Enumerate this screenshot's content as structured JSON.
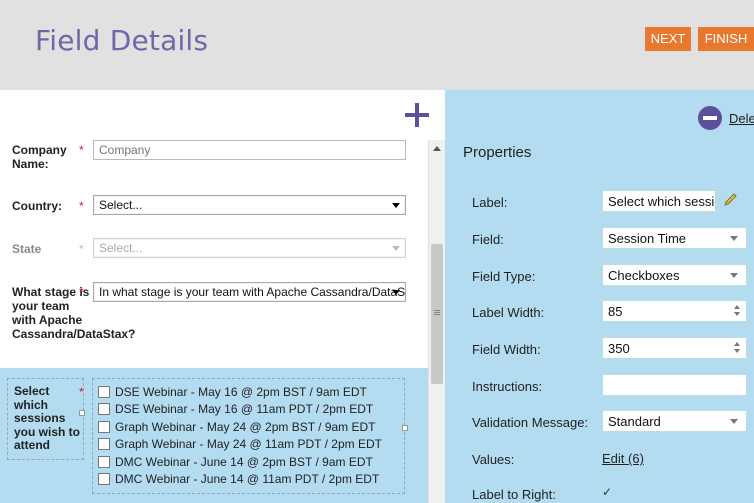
{
  "header": {
    "title": "Field Details",
    "next_label": "NEXT",
    "finish_label": "FINISH"
  },
  "form": {
    "fields": [
      {
        "label": "Company Name:",
        "required": "*",
        "placeholder": "Company"
      },
      {
        "label": "Country:",
        "required": "*",
        "value": "Select..."
      },
      {
        "label": "State",
        "required": "*",
        "value": "Select..."
      },
      {
        "label": "What stage is your team with Apache Cassandra/DataStax?",
        "required": "*",
        "value": "In what stage is your team with Apache Cassandra/DataStax?"
      },
      {
        "label": "Select which sessions you wish to attend",
        "required": "*"
      }
    ],
    "session_options": [
      "DSE Webinar - May 16 @ 2pm BST / 9am EDT",
      "DSE Webinar - May 16 @ 11am PDT / 2pm EDT",
      "Graph Webinar - May 24 @ 2pm BST / 9am EDT",
      "Graph Webinar - May 24 @ 11am PDT / 2pm EDT",
      "DMC Webinar - June 14 @ 2pm BST / 9am EDT",
      "DMC Webinar - June 14 @ 11am PDT / 2pm EDT"
    ]
  },
  "properties": {
    "title": "Properties",
    "delete_label": "Delete",
    "rows": [
      {
        "label": "Label:",
        "value": "Select which sessions you wish to attend"
      },
      {
        "label": "Field:",
        "value": "Session Time"
      },
      {
        "label": "Field Type:",
        "value": "Checkboxes"
      },
      {
        "label": "Label Width:",
        "value": "85"
      },
      {
        "label": "Field Width:",
        "value": "350"
      },
      {
        "label": "Instructions:",
        "value": ""
      },
      {
        "label": "Validation Message:",
        "value": "Standard"
      },
      {
        "label": "Values:",
        "value": "Edit (6)"
      },
      {
        "label": "Label to Right:",
        "value": "✓"
      }
    ]
  },
  "colors": {
    "accent_orange": "#e9782f",
    "title_purple": "#6d68a8",
    "panel_blue": "#b3dcf1",
    "icon_purple": "#5d4f9b"
  }
}
